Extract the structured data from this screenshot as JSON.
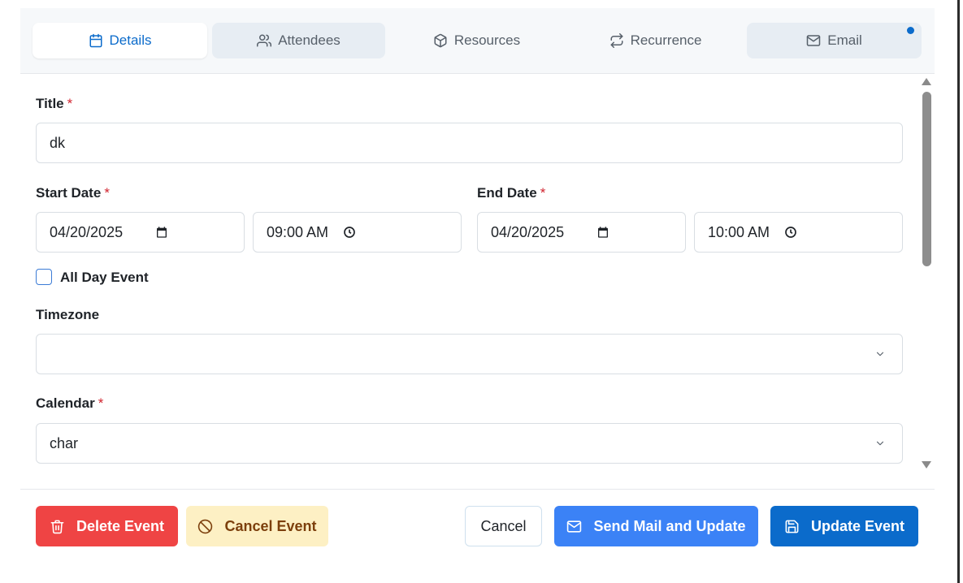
{
  "tabs": [
    {
      "label": "Details",
      "icon": "calendar-icon",
      "state": "active"
    },
    {
      "label": "Attendees",
      "icon": "users-icon",
      "state": "shaded"
    },
    {
      "label": "Resources",
      "icon": "box-icon",
      "state": "plain"
    },
    {
      "label": "Recurrence",
      "icon": "repeat-icon",
      "state": "plain"
    },
    {
      "label": "Email",
      "icon": "mail-icon",
      "state": "shaded",
      "has_notification_dot": true
    }
  ],
  "form": {
    "title_label": "Title",
    "title_value": "dk",
    "required_mark": "*",
    "start_date_label": "Start Date",
    "start_date_value": "04/20/2025",
    "start_time_value": "09:00 AM",
    "end_date_label": "End Date",
    "end_date_value": "04/20/2025",
    "end_time_value": "10:00 AM",
    "all_day_label": "All Day Event",
    "all_day_checked": false,
    "timezone_label": "Timezone",
    "timezone_value": "",
    "calendar_label": "Calendar",
    "calendar_value": "char"
  },
  "footer": {
    "delete_label": "Delete Event",
    "cancel_event_label": "Cancel Event",
    "cancel_label": "Cancel",
    "send_mail_label": "Send Mail and Update",
    "update_label": "Update Event"
  },
  "colors": {
    "accent": "#0b6bcb",
    "danger": "#ef4444",
    "warning_bg": "#fdf0c4",
    "warning_text": "#7c3f0c",
    "send_bg": "#3b82f6",
    "required": "#d1242f"
  }
}
